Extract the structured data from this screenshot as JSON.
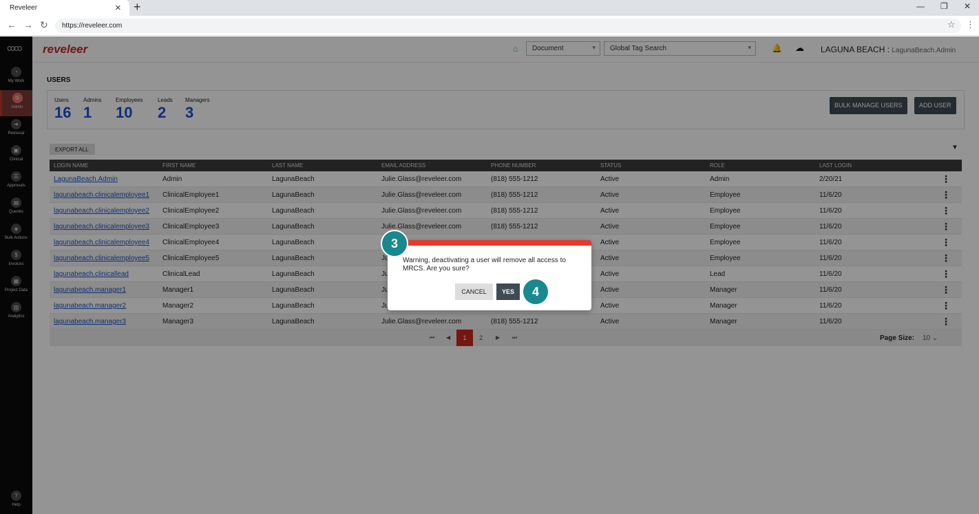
{
  "browser": {
    "tab_title": "Reveleer",
    "url": "https://reveleer.com"
  },
  "sidebar": {
    "items": [
      {
        "label": "My Work",
        "icon": "dashboard-icon"
      },
      {
        "label": "Admin",
        "icon": "admin-icon"
      },
      {
        "label": "Retrieval",
        "icon": "retrieval-icon"
      },
      {
        "label": "Clinical",
        "icon": "clinical-icon"
      },
      {
        "label": "Approvals",
        "icon": "approvals-icon"
      },
      {
        "label": "Queries",
        "icon": "queries-icon"
      },
      {
        "label": "Bulk Actions",
        "icon": "layers-icon"
      },
      {
        "label": "Invoices",
        "icon": "dollar-icon"
      },
      {
        "label": "Project Data",
        "icon": "data-icon"
      },
      {
        "label": "Analytics",
        "icon": "chart-icon"
      },
      {
        "label": "Help",
        "icon": "help-icon"
      }
    ]
  },
  "header": {
    "brand": "reveleer",
    "document_select": "Document",
    "tag_search": "Global Tag Search",
    "org": "LAGUNA BEACH :",
    "user": "LagunaBeach.Admin"
  },
  "page": {
    "title": "USERS",
    "stats": [
      {
        "label": "Users",
        "value": "16"
      },
      {
        "label": "Admins",
        "value": "1"
      },
      {
        "label": "Employees",
        "value": "10"
      },
      {
        "label": "Leads",
        "value": "2"
      },
      {
        "label": "Managers",
        "value": "3"
      }
    ],
    "bulk_manage_label": "BULK MANAGE USERS",
    "add_user_label": "ADD USER",
    "export_label": "EXPORT ALL"
  },
  "table": {
    "columns": [
      "LOGIN NAME",
      "FIRST NAME",
      "LAST NAME",
      "EMAIL ADDRESS",
      "PHONE NUMBER",
      "STATUS",
      "ROLE",
      "LAST LOGIN"
    ],
    "rows": [
      [
        "LagunaBeach.Admin",
        "Admin",
        "LagunaBeach",
        "Julie.Glass@reveleer.com",
        "(818) 555-1212",
        "Active",
        "Admin",
        "2/20/21"
      ],
      [
        "lagunabeach.clinicalemployee1",
        "ClinicalEmployee1",
        "LagunaBeach",
        "Julie.Glass@reveleer.com",
        "(818) 555-1212",
        "Active",
        "Employee",
        "11/6/20"
      ],
      [
        "lagunabeach.clinicalemployee2",
        "ClinicalEmployee2",
        "LagunaBeach",
        "Julie.Glass@reveleer.com",
        "(818) 555-1212",
        "Active",
        "Employee",
        "11/6/20"
      ],
      [
        "lagunabeach.clinicalemployee3",
        "ClinicalEmployee3",
        "LagunaBeach",
        "Julie.Glass@reveleer.com",
        "(818) 555-1212",
        "Active",
        "Employee",
        "11/6/20"
      ],
      [
        "lagunabeach.clinicalemployee4",
        "ClinicalEmployee4",
        "LagunaBeach",
        "",
        "",
        "Active",
        "Employee",
        "11/6/20"
      ],
      [
        "lagunabeach.clinicalemployee5",
        "ClinicalEmployee5",
        "LagunaBeach",
        "Ju",
        "",
        "Active",
        "Employee",
        "11/6/20"
      ],
      [
        "lagunabeach.clinicallead",
        "ClinicalLead",
        "LagunaBeach",
        "Ju",
        "",
        "Active",
        "Lead",
        "11/6/20"
      ],
      [
        "lagunabeach.manager1",
        "Manager1",
        "LagunaBeach",
        "Ju",
        "",
        "Active",
        "Manager",
        "11/6/20"
      ],
      [
        "lagunabeach.manager2",
        "Manager2",
        "LagunaBeach",
        "Ju",
        "",
        "Active",
        "Manager",
        "11/6/20"
      ],
      [
        "lagunabeach.manager3",
        "Manager3",
        "LagunaBeach",
        "Julie.Glass@reveleer.com",
        "(818) 555-1212",
        "Active",
        "Manager",
        "11/6/20"
      ]
    ]
  },
  "pagination": {
    "first": "⏮",
    "prev": "◀",
    "current": "1",
    "next_page": "2",
    "next": "▶",
    "last": "⏭",
    "page_size_label": "Page Size:",
    "page_size_value": "10 ⌄"
  },
  "dialog": {
    "message": "Warning, deactivating a user will remove all access to MRCS. Are you sure?",
    "cancel_label": "CANCEL",
    "yes_label": "YES",
    "step_a": "3",
    "step_b": "4",
    "accent_color": "#e8392a",
    "badge_color": "#18898e"
  }
}
